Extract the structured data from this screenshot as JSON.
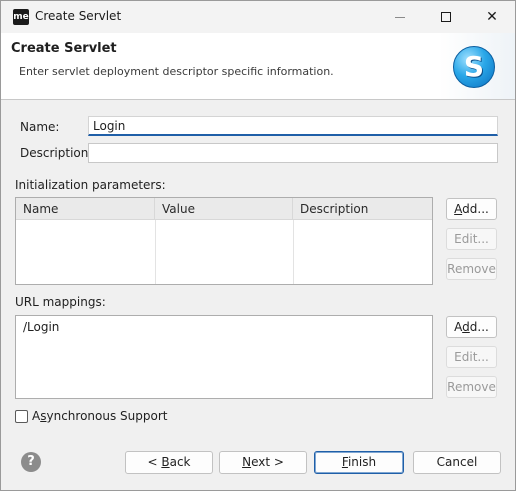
{
  "window": {
    "app_icon_text": "me",
    "title": "Create Servlet",
    "close_glyph": "✕"
  },
  "banner": {
    "title": "Create Servlet",
    "description": "Enter servlet deployment descriptor specific information.",
    "logo_letter": "S"
  },
  "form": {
    "name_label": "Name:",
    "name_value": "Login",
    "description_label": "Description:",
    "description_value": ""
  },
  "init_params": {
    "label": "Initialization parameters:",
    "columns": [
      "Name",
      "Value",
      "Description"
    ],
    "rows": [],
    "buttons": {
      "add": {
        "pre": "",
        "key": "A",
        "post": "dd..."
      },
      "edit": "Edit...",
      "remove": "Remove"
    }
  },
  "url_mappings": {
    "label": "URL mappings:",
    "items": [
      "/Login"
    ],
    "buttons": {
      "add": {
        "pre": "A",
        "key": "d",
        "post": "d..."
      },
      "edit": "Edit...",
      "remove": "Remove"
    }
  },
  "async": {
    "pre": "A",
    "key": "s",
    "post": "ynchronous Support",
    "checked": false
  },
  "footer": {
    "help_glyph": "?",
    "back": {
      "pre": "< ",
      "key": "B",
      "post": "ack"
    },
    "next": {
      "pre": "",
      "key": "N",
      "post": "ext >"
    },
    "finish": {
      "pre": "",
      "key": "F",
      "post": "inish"
    },
    "cancel": "Cancel"
  },
  "colors": {
    "accent": "#1f5fa8",
    "dialog_bg": "#f0f0f0"
  }
}
